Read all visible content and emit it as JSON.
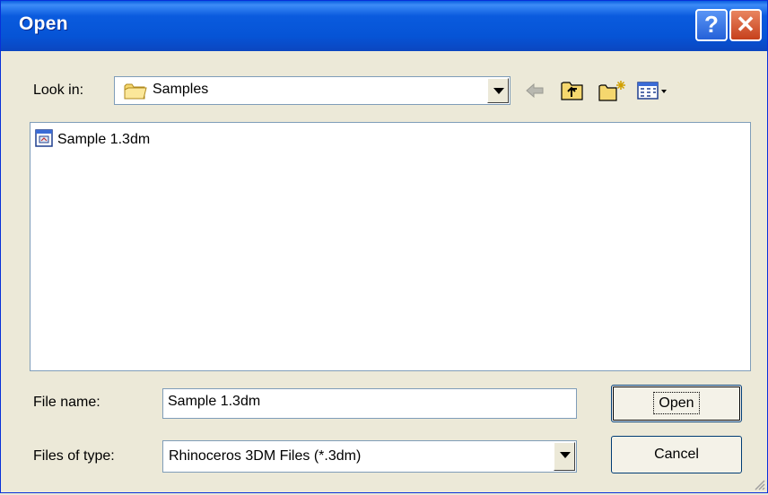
{
  "window": {
    "title": "Open"
  },
  "title_buttons": {
    "help": "?",
    "close": "✕"
  },
  "look_in": {
    "label": "Look in:",
    "value": "Samples"
  },
  "toolbar": {
    "icons": [
      "back-arrow-icon",
      "up-folder-icon",
      "new-folder-icon",
      "view-menu-icon"
    ]
  },
  "files": [
    {
      "name": "Sample 1.3dm",
      "icon": "rhino-3dm-file-icon"
    }
  ],
  "file_name": {
    "label": "File name:",
    "value": "Sample 1.3dm"
  },
  "file_type": {
    "label": "Files of type:",
    "value": "Rhinoceros 3DM Files (*.3dm)"
  },
  "buttons": {
    "open": "Open",
    "cancel": "Cancel"
  },
  "colors": {
    "titlebar": "#0654d6",
    "dialog_bg": "#ece9d8",
    "border": "#7f9db9"
  }
}
